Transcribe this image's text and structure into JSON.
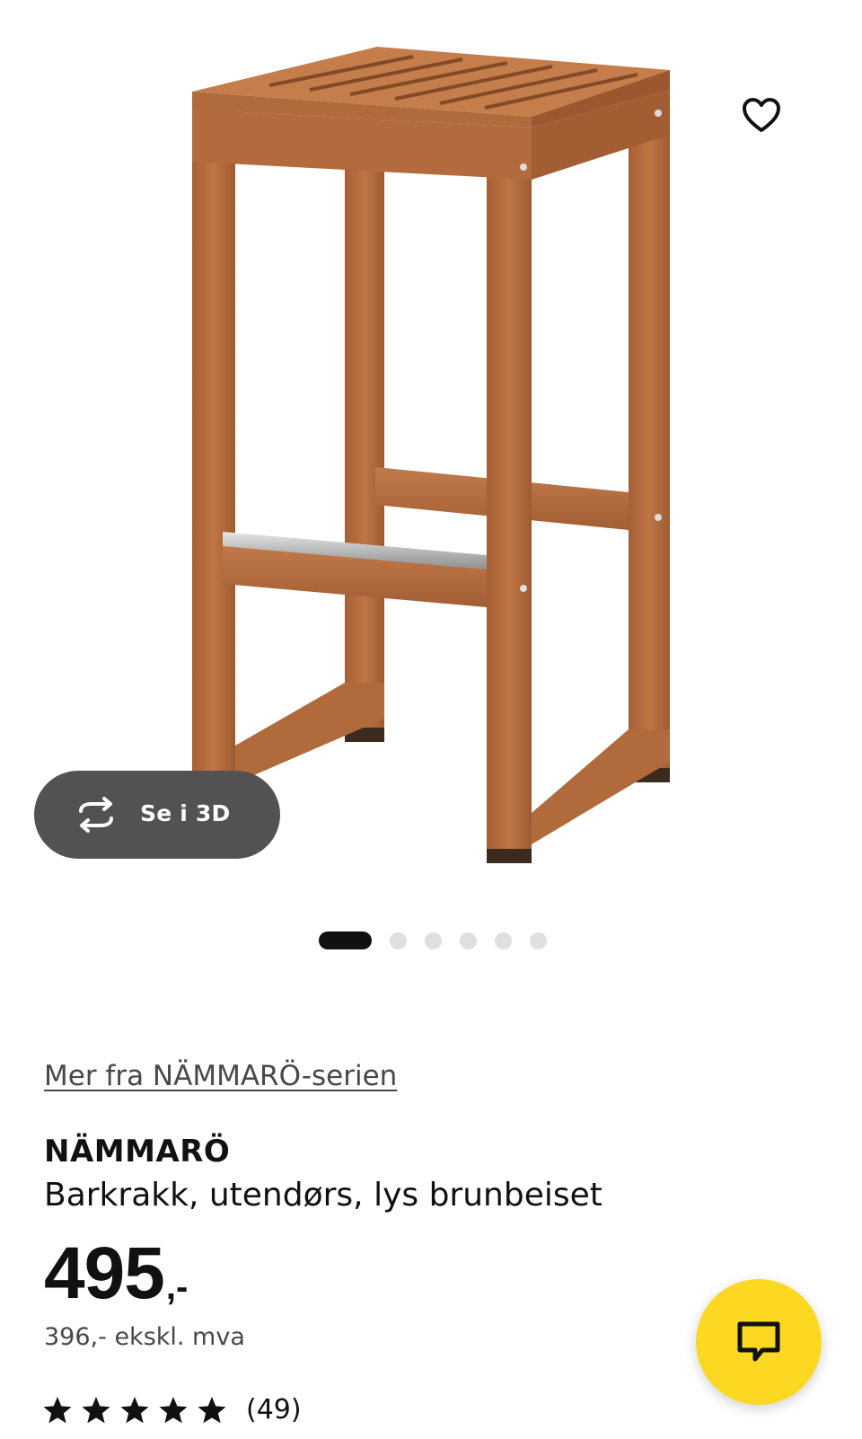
{
  "gallery": {
    "view_3d_label": "Se i 3D",
    "slide_count": 6,
    "active_slide": 1
  },
  "product": {
    "series_link": "Mer fra NÄMMARÖ-serien",
    "name": "NÄMMARÖ",
    "description": "Barkrakk, utendørs, lys brunbeiset",
    "price_main": "495",
    "price_suffix": ",-",
    "price_ex_vat": "396,- ekskl. mva",
    "rating_stars": 5,
    "rating_count": "(49)"
  },
  "icons": {
    "favorite": "heart-icon",
    "view_3d": "rotate-3d-icon",
    "chat": "chat-bubble-icon",
    "rating": "star-icon"
  },
  "colors": {
    "wood": "#b1683c",
    "wood_dark": "#8e4f28",
    "pill_bg": "#525252",
    "dot_active": "#111111",
    "dot_inactive": "#dfdfdf",
    "chat_yellow": "#fcd823",
    "secondary_text": "#484848"
  }
}
